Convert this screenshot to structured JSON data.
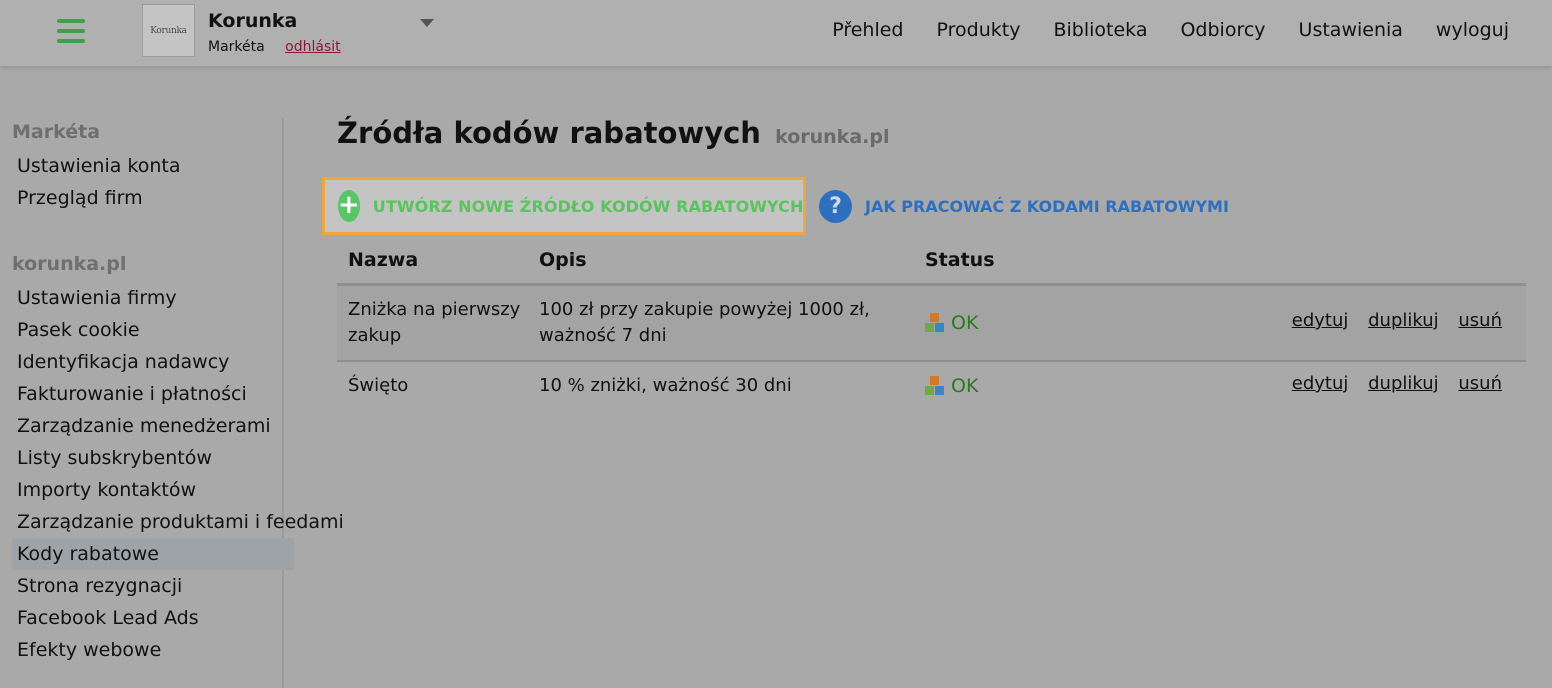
{
  "header": {
    "logo_text": "Korunka",
    "company_name": "Korunka",
    "user_name": "Markéta",
    "logout_small": "odhlásit",
    "nav": [
      "Přehled",
      "Produkty",
      "Biblioteka",
      "Odbiorcy",
      "Ustawienia",
      "wyloguj"
    ]
  },
  "sidebar": {
    "section1_title": "Markéta",
    "section1_items": [
      "Ustawienia konta",
      "Przegląd firm"
    ],
    "section2_title": "korunka.pl",
    "section2_items": [
      "Ustawienia firmy",
      "Pasek cookie",
      "Identyfikacja nadawcy",
      "Fakturowanie i płatności",
      "Zarządzanie menedżerami",
      "Listy subskrybentów",
      "Importy kontaktów",
      "Zarządzanie produktami i feedami",
      "Kody rabatowe",
      "Strona rezygnacji",
      "Facebook Lead Ads",
      "Efekty webowe"
    ],
    "active_item": "Kody rabatowe"
  },
  "main": {
    "title": "Źródła kodów rabatowych",
    "domain": "korunka.pl",
    "create_label": "UTWÓRZ NOWE ŹRÓDŁO KODÓW RABATOWYCH",
    "help_label": "JAK PRACOWAĆ Z KODAMI RABATOWYMI",
    "table": {
      "headers": [
        "Nazwa",
        "Opis",
        "Status"
      ],
      "rows": [
        {
          "name": "Zniżka na pierwszy zakup",
          "desc": "100 zł przy zakupie powyżej 1000 zł, ważność 7 dni",
          "status": "OK"
        },
        {
          "name": "Święto",
          "desc": "10 % zniżki, ważność 30 dni",
          "status": "OK"
        }
      ],
      "actions": [
        "edytuj",
        "duplikuj",
        "usuń"
      ]
    }
  },
  "colors": {
    "accent_green": "#59c45d",
    "help_blue": "#2f6fc0",
    "highlight_border": "#f0a640",
    "status_ok": "#2a7a22"
  }
}
